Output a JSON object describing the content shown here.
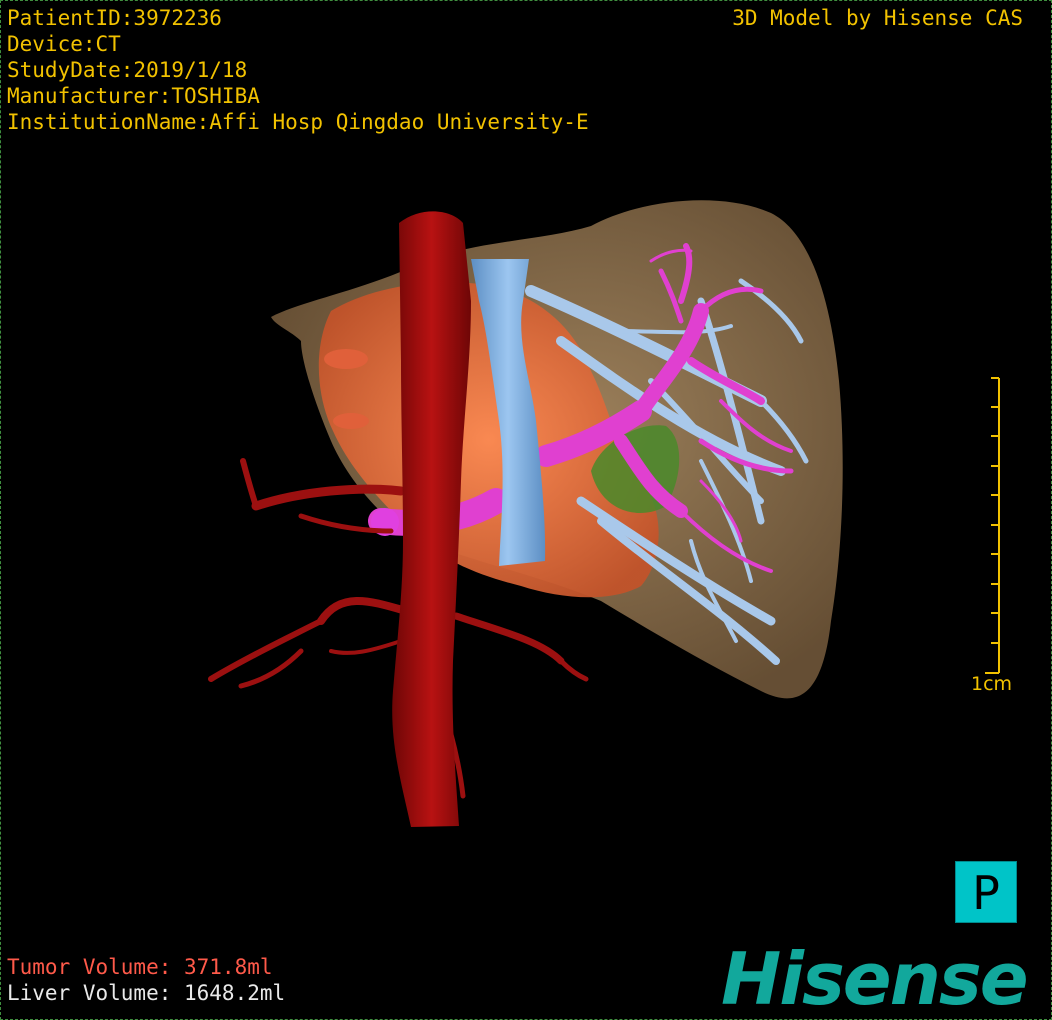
{
  "patient_info": {
    "patient_id": "PatientID:3972236",
    "device": "Device:CT",
    "study_date": "StudyDate:2019/1/18",
    "manufacturer": "Manufacturer:TOSHIBA",
    "institution": "InstitutionName:Affi Hosp Qingdao University-E"
  },
  "credit": "3D Model by Hisense CAS",
  "scale_bar": {
    "label": "1cm"
  },
  "orientation_marker": "P",
  "volumes": {
    "tumor": "Tumor Volume:  371.8ml",
    "liver": "Liver Volume: 1648.2ml"
  },
  "brand": "Hisense",
  "colors": {
    "text_info": "#f2c200",
    "tumor_text": "#ff5a4a",
    "liver_text": "#e9e9e9",
    "liver": "#9a7a52",
    "tumor": "#f07a45",
    "aorta": "#a30d0d",
    "vena_cava": "#7fb4e6",
    "portal_vein": "#e040d0",
    "hepatic_vein": "#a9c8ea",
    "gallbladder": "#4a8a2a",
    "orientation_box": "#00c4c8",
    "brand": "#12a89c"
  }
}
